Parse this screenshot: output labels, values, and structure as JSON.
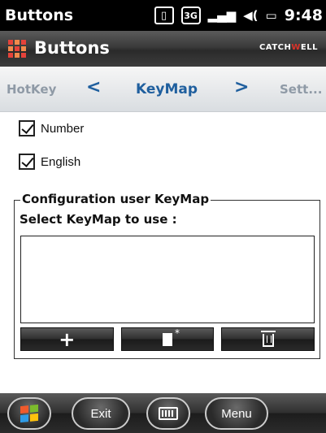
{
  "status_bar": {
    "app_name": "Buttons",
    "icons": [
      "device-icon",
      "3g-icon",
      "signal-icon",
      "volume-icon",
      "battery-icon"
    ],
    "network_label": "3G",
    "time": "9:48"
  },
  "title_bar": {
    "title": "Buttons",
    "brand_part1": "CATCH",
    "brand_accent": "W",
    "brand_part2": "ELL",
    "brand_accent_color": "#d9332a"
  },
  "tabs": {
    "previous": "HotKey",
    "current": "KeyMap",
    "next": "Sett...",
    "prev_arrow": "<",
    "next_arrow": ">",
    "active_color": "#1f5f9e"
  },
  "options": {
    "number_label": "Number",
    "number_checked": true,
    "english_label": "English",
    "english_checked": true
  },
  "configuration": {
    "group_title": "Configuration user KeyMap",
    "select_label": "Select KeyMap to use :",
    "keymap_items": []
  },
  "toolbar": {
    "add": "+",
    "clear": "clear-icon",
    "delete": "trash-icon"
  },
  "bottom_bar": {
    "exit_label": "Exit",
    "menu_label": "Menu"
  }
}
